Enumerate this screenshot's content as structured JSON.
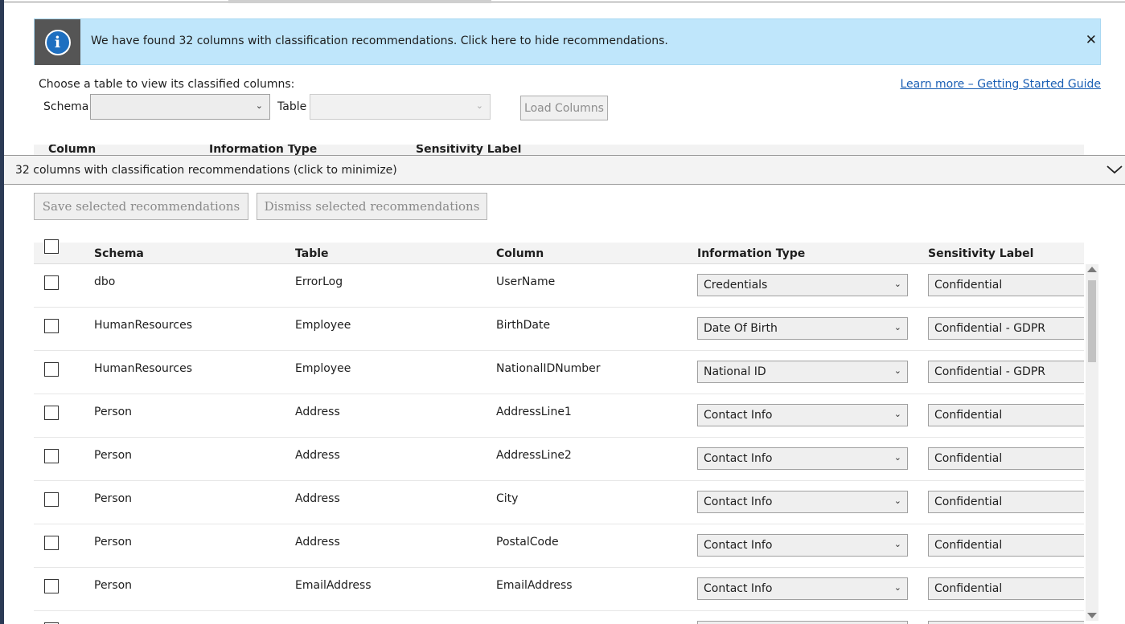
{
  "banner": {
    "icon": "info-icon",
    "icon_glyph": "i",
    "message": "We have found 32 columns with classification recommendations. Click here to hide recommendations.",
    "close_glyph": "✕",
    "background": "#bfe6fb"
  },
  "picker": {
    "prompt": "Choose a table to view its classified columns:",
    "learn_more": "Learn more – Getting Started Guide",
    "schema_label": "Schema",
    "schema_value": "",
    "table_label": "Table",
    "table_value": "",
    "load_button": "Load Columns"
  },
  "classified_header": {
    "column": "Column",
    "information_type": "Information Type",
    "sensitivity_label": "Sensitivity Label"
  },
  "recommendations": {
    "bar_text": "32 columns with classification recommendations (click to minimize)",
    "save_button": "Save selected recommendations",
    "dismiss_button": "Dismiss selected recommendations",
    "headers": {
      "schema": "Schema",
      "table": "Table",
      "column": "Column",
      "information_type": "Information Type",
      "sensitivity_label": "Sensitivity Label"
    },
    "rows": [
      {
        "schema": "dbo",
        "table": "ErrorLog",
        "column": "UserName",
        "information_type": "Credentials",
        "sensitivity_label": "Confidential"
      },
      {
        "schema": "HumanResources",
        "table": "Employee",
        "column": "BirthDate",
        "information_type": "Date Of Birth",
        "sensitivity_label": "Confidential - GDPR"
      },
      {
        "schema": "HumanResources",
        "table": "Employee",
        "column": "NationalIDNumber",
        "information_type": "National ID",
        "sensitivity_label": "Confidential - GDPR"
      },
      {
        "schema": "Person",
        "table": "Address",
        "column": "AddressLine1",
        "information_type": "Contact Info",
        "sensitivity_label": "Confidential"
      },
      {
        "schema": "Person",
        "table": "Address",
        "column": "AddressLine2",
        "information_type": "Contact Info",
        "sensitivity_label": "Confidential"
      },
      {
        "schema": "Person",
        "table": "Address",
        "column": "City",
        "information_type": "Contact Info",
        "sensitivity_label": "Confidential"
      },
      {
        "schema": "Person",
        "table": "Address",
        "column": "PostalCode",
        "information_type": "Contact Info",
        "sensitivity_label": "Confidential"
      },
      {
        "schema": "Person",
        "table": "EmailAddress",
        "column": "EmailAddress",
        "information_type": "Contact Info",
        "sensitivity_label": "Confidential"
      },
      {
        "schema": "",
        "table": "",
        "column": "",
        "information_type": "",
        "sensitivity_label": ""
      }
    ]
  },
  "icons": {
    "dropdown": "chevron-down-icon",
    "expand": "chevron-down-icon",
    "scroll_up": "arrow-up-icon",
    "scroll_down": "arrow-down-icon"
  }
}
